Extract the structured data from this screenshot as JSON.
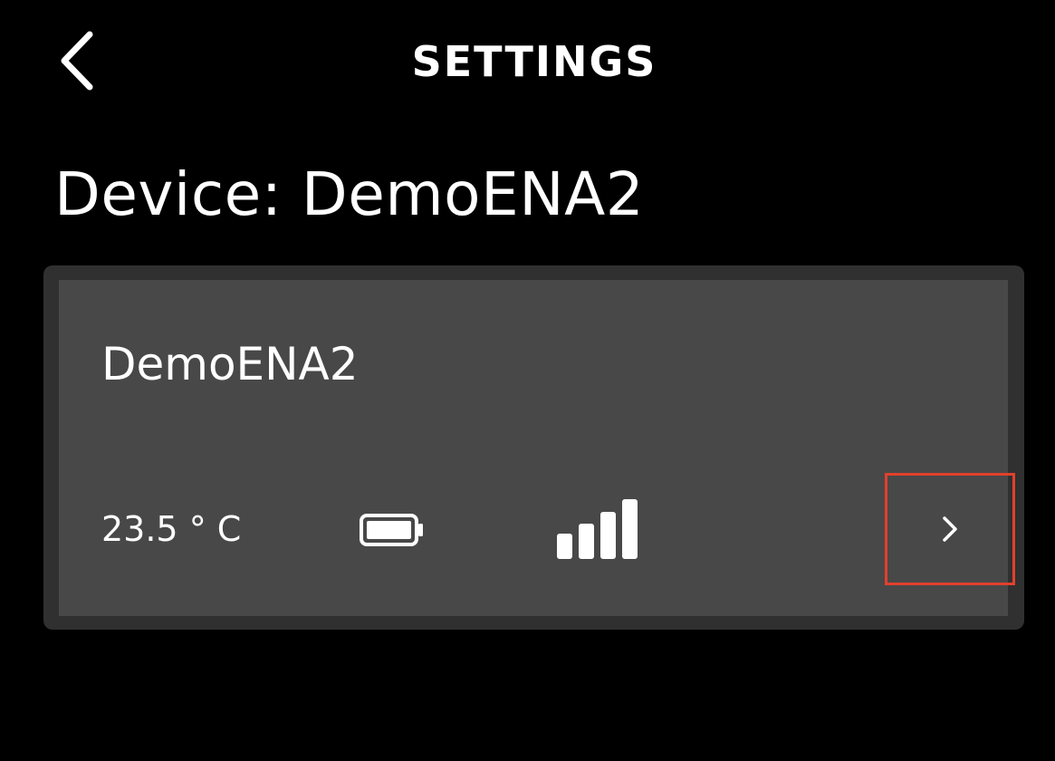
{
  "header": {
    "title": "SETTINGS",
    "back_icon": "chevron-left-icon"
  },
  "device_heading": "Device: DemoENA2",
  "device_card": {
    "name": "DemoENA2",
    "temperature": "23.5 ° C",
    "battery_icon": "battery-full-icon",
    "signal_icon": "signal-strength-icon",
    "signal_level": "4/4",
    "open_icon": "chevron-right-icon"
  },
  "colors": {
    "background": "#000000",
    "card": "#484848",
    "card_frame": "#303030",
    "text": "#ffffff",
    "highlight": "#e2402c"
  }
}
